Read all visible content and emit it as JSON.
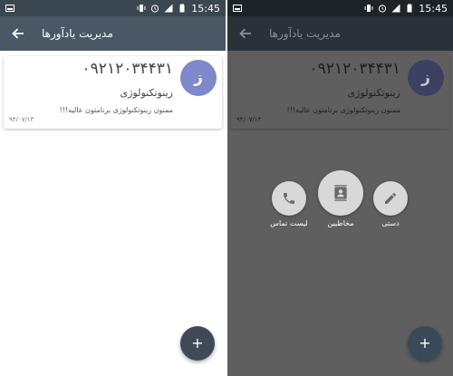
{
  "statusbar": {
    "time": "15:45"
  },
  "appbar": {
    "title": "مدیریت یادآورها"
  },
  "reminder": {
    "avatar_letter": "ز",
    "phone_number": "۰۹۲۱۲۰۳۴۴۳۱",
    "contact_name": "زینوتکنولوژی",
    "message": "ممنون زینوتکنولوژی برنامتون عالیه!!!",
    "date": "۹۴/۰۷/۱۳"
  },
  "fab": {
    "label": "+"
  },
  "add_options": [
    {
      "label": "لیست تماس",
      "icon": "phone-icon"
    },
    {
      "label": "مخاطبین",
      "icon": "contacts-icon"
    },
    {
      "label": "دستی",
      "icon": "pencil-icon"
    }
  ],
  "colors": {
    "appbar": "#4a5866",
    "statusbar": "#3a4650",
    "avatar": "#7f88c9",
    "fab": "#3f4a55",
    "overlay": "#5f5f5f"
  }
}
